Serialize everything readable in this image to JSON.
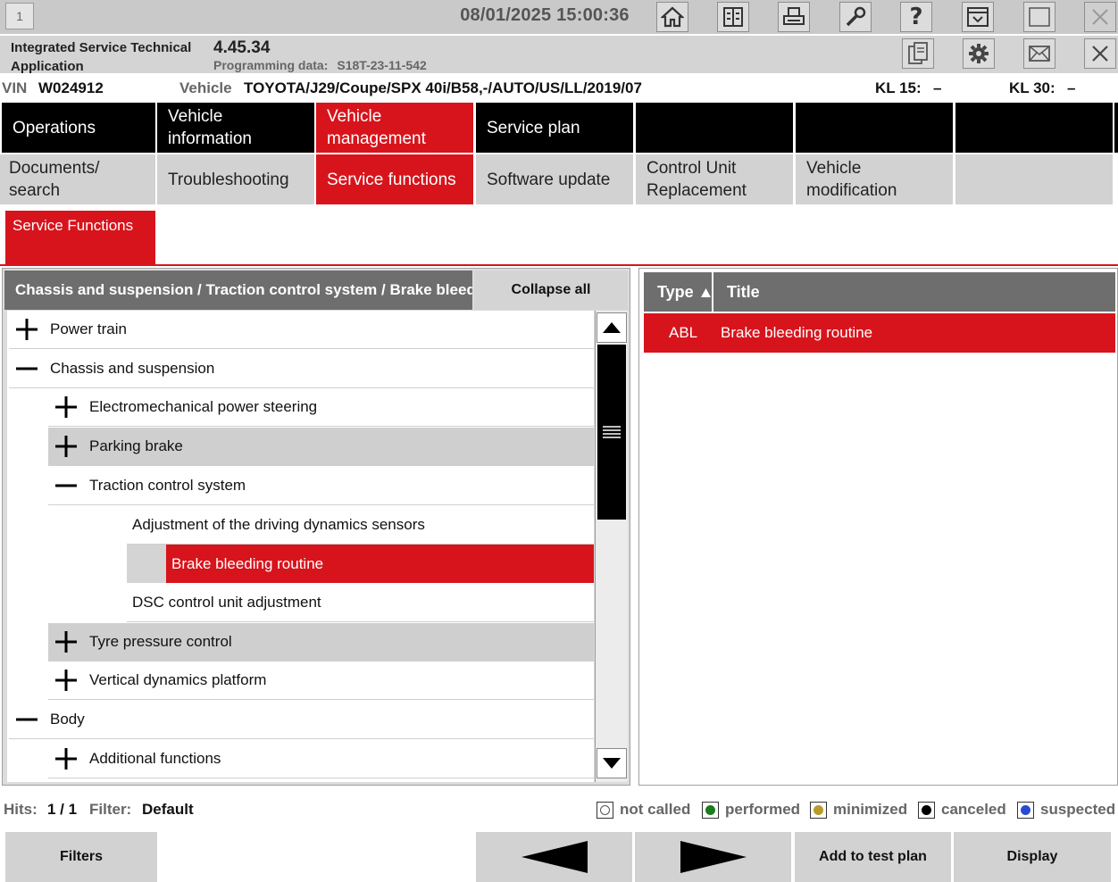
{
  "topbar": {
    "window_number": "1",
    "datetime": "08/01/2025 15:00:36",
    "icons": [
      "home-icon",
      "ecu-info-icon",
      "print-icon",
      "wrench-icon",
      "help-icon",
      "dropdown-panel-icon",
      "window-icon",
      "close-x-icon"
    ]
  },
  "app": {
    "name": "Integrated Service Technical Application",
    "version": "4.45.34",
    "programming_label": "Programming data:",
    "programming_value": "S18T-23-11-542",
    "icons": [
      "clipboard-icon",
      "settings-gear-icon",
      "mail-icon",
      "close-x-icon"
    ]
  },
  "vehicle": {
    "vin_label": "VIN",
    "vin": "W024912",
    "vehicle_label": "Vehicle",
    "vehicle": "TOYOTA/J29/Coupe/SPX 40i/B58,-/AUTO/US/LL/2019/07",
    "kl15_label": "KL 15:",
    "kl15_value": "–",
    "kl30_label": "KL 30:",
    "kl30_value": "–"
  },
  "nav_main": [
    "Operations",
    "Vehicle information",
    "Vehicle management",
    "Service plan",
    "",
    "",
    ""
  ],
  "nav_main_active": "Vehicle management",
  "nav_sub": [
    "Documents/ search",
    "Troubleshooting",
    "Service functions",
    "Software update",
    "Control Unit Replacement",
    "Vehicle modification",
    ""
  ],
  "nav_sub_active": "Service functions",
  "subtab": "Service Functions",
  "tree_panel": {
    "path": "Chassis and suspension / Traction control system / Brake bleeding routine",
    "collapse_all": "Collapse all",
    "items": [
      {
        "label": "Power train",
        "level": 0,
        "state": "expand"
      },
      {
        "label": "Chassis and suspension",
        "level": 0,
        "state": "collapse"
      },
      {
        "label": "Electromechanical power steering",
        "level": 1,
        "state": "expand"
      },
      {
        "label": "Parking brake",
        "level": 1,
        "state": "expand",
        "shaded": true
      },
      {
        "label": "Traction control system",
        "level": 1,
        "state": "collapse"
      },
      {
        "label": "Adjustment of the driving dynamics sensors",
        "level": 2,
        "state": "leaf"
      },
      {
        "label": "Brake bleeding routine",
        "level": 2,
        "state": "leaf",
        "selected": true
      },
      {
        "label": "DSC control unit adjustment",
        "level": 2,
        "state": "leaf"
      },
      {
        "label": "Tyre pressure control",
        "level": 1,
        "state": "expand",
        "shaded": true
      },
      {
        "label": "Vertical dynamics platform",
        "level": 1,
        "state": "expand"
      },
      {
        "label": "Body",
        "level": 0,
        "state": "collapse"
      },
      {
        "label": "Additional functions",
        "level": 1,
        "state": "expand"
      }
    ]
  },
  "list_panel": {
    "col_type": "Type",
    "col_title": "Title",
    "rows": [
      {
        "type": "ABL",
        "title": "Brake bleeding routine"
      }
    ]
  },
  "status": {
    "hits_label": "Hits:",
    "hits_value": "1 / 1",
    "filter_label": "Filter:",
    "filter_value": "Default",
    "legend": [
      {
        "label": "not called",
        "color": "#ffffff"
      },
      {
        "label": "performed",
        "color": "#1d7a1d"
      },
      {
        "label": "minimized",
        "color": "#b89a2c"
      },
      {
        "label": "canceled",
        "color": "#000000"
      },
      {
        "label": "suspected",
        "color": "#2a4bd0"
      }
    ]
  },
  "buttons": {
    "filters": "Filters",
    "add_to_test_plan": "Add to test plan",
    "display": "Display"
  },
  "colors": {
    "accent": "#d7141c",
    "nav_dark": "#000000",
    "panel_header": "#6e6e6e"
  }
}
